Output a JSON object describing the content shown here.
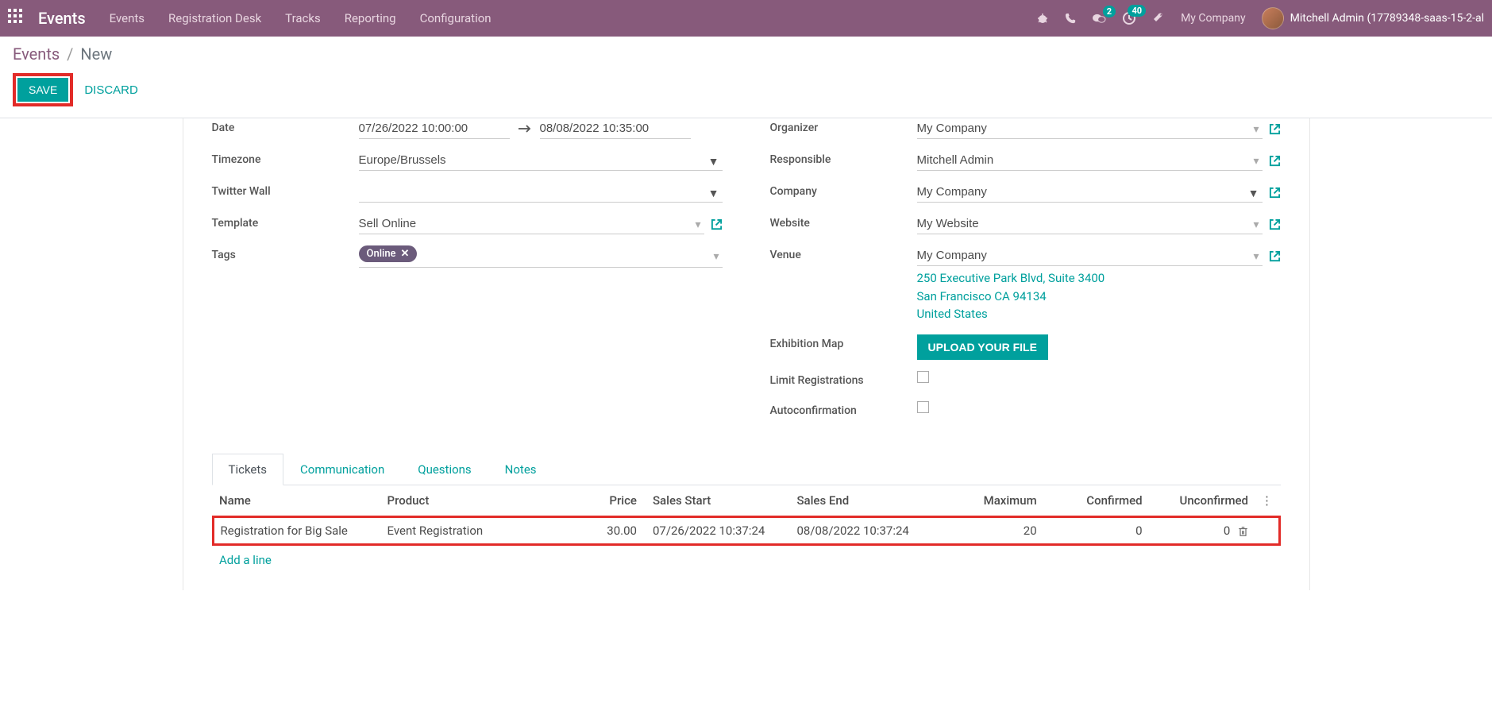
{
  "navbar": {
    "brand": "Events",
    "links": [
      "Events",
      "Registration Desk",
      "Tracks",
      "Reporting",
      "Configuration"
    ],
    "msg_badge": "2",
    "clock_badge": "40",
    "company": "My Company",
    "user": "Mitchell Admin (17789348-saas-15-2-al"
  },
  "breadcrumb": {
    "root": "Events",
    "current": "New"
  },
  "actions": {
    "save": "SAVE",
    "discard": "DISCARD"
  },
  "form": {
    "left": {
      "date_label": "Date",
      "date_start": "07/26/2022 10:00:00",
      "date_end": "08/08/2022 10:35:00",
      "tz_label": "Timezone",
      "tz": "Europe/Brussels",
      "twitter_label": "Twitter Wall",
      "twitter": "",
      "template_label": "Template",
      "template": "Sell Online",
      "tags_label": "Tags",
      "tag": "Online"
    },
    "right": {
      "organizer_label": "Organizer",
      "organizer": "My Company",
      "responsible_label": "Responsible",
      "responsible": "Mitchell Admin",
      "company_label": "Company",
      "company": "My Company",
      "website_label": "Website",
      "website": "My Website",
      "venue_label": "Venue",
      "venue": "My Company",
      "address_line1": "250 Executive Park Blvd, Suite 3400",
      "address_line2": "San Francisco CA 94134",
      "address_country": "United States",
      "exhibition_label": "Exhibition Map",
      "upload": "UPLOAD YOUR FILE",
      "limit_label": "Limit Registrations",
      "autoconfirm_label": "Autoconfirmation"
    }
  },
  "tabs": [
    "Tickets",
    "Communication",
    "Questions",
    "Notes"
  ],
  "table": {
    "headers": {
      "name": "Name",
      "product": "Product",
      "price": "Price",
      "start": "Sales Start",
      "end": "Sales End",
      "max": "Maximum",
      "confirmed": "Confirmed",
      "unconfirmed": "Unconfirmed"
    },
    "row": {
      "name": "Registration for Big Sale",
      "product": "Event Registration",
      "price": "30.00",
      "start": "07/26/2022 10:37:24",
      "end": "08/08/2022 10:37:24",
      "max": "20",
      "confirmed": "0",
      "unconfirmed": "0"
    },
    "add_line": "Add a line"
  }
}
